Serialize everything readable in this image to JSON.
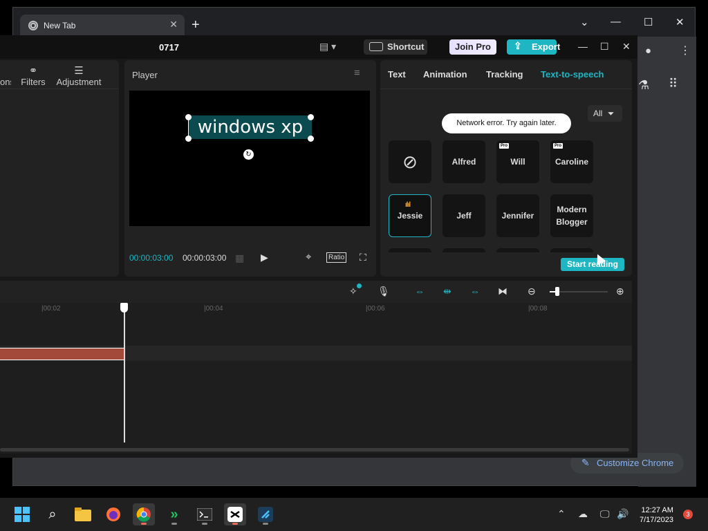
{
  "chrome": {
    "tab_title": "New Tab",
    "new_tab": "+",
    "customize_label": "Customize Chrome"
  },
  "capcut": {
    "project_title": "0717",
    "shortcut_label": "Shortcut",
    "joinpro_label": "Join Pro",
    "export_label": "Export",
    "left_tabs": [
      {
        "label": "ons",
        "icon": "transitions-icon"
      },
      {
        "label": "Filters",
        "icon": "filters-icon"
      },
      {
        "label": "Adjustment",
        "icon": "adjustment-icon"
      }
    ],
    "player": {
      "title": "Player",
      "overlay_text": "windows xp",
      "time_current": "00:00:03:00",
      "time_total": "00:00:03:00",
      "ratio_label": "Ratio"
    },
    "right_tabs": [
      "Text",
      "Animation",
      "Tracking",
      "Text-to-speech"
    ],
    "active_right_tab": "Text-to-speech",
    "filter_label": "All",
    "toast": "Network error. Try again later.",
    "voices": [
      {
        "name": "",
        "type": "none"
      },
      {
        "name": "Alfred",
        "pro": false
      },
      {
        "name": "Will",
        "pro": true
      },
      {
        "name": "Caroline",
        "pro": true
      },
      {
        "name": "Jessie",
        "pro": false,
        "selected": true
      },
      {
        "name": "Jeff",
        "pro": false
      },
      {
        "name": "Jennifer",
        "pro": false
      },
      {
        "name": "Modern Blogger",
        "pro": false
      }
    ],
    "pro_badge": "Pro",
    "start_reading_label": "Start reading",
    "ruler_ticks": [
      "|00:02",
      "|00:04",
      "|00:06",
      "|00:08"
    ]
  },
  "taskbar": {
    "time": "12:27 AM",
    "date": "7/17/2023",
    "notifications": "3"
  },
  "colors": {
    "accent": "#1fb6c3",
    "clip": "#a34a3a"
  }
}
